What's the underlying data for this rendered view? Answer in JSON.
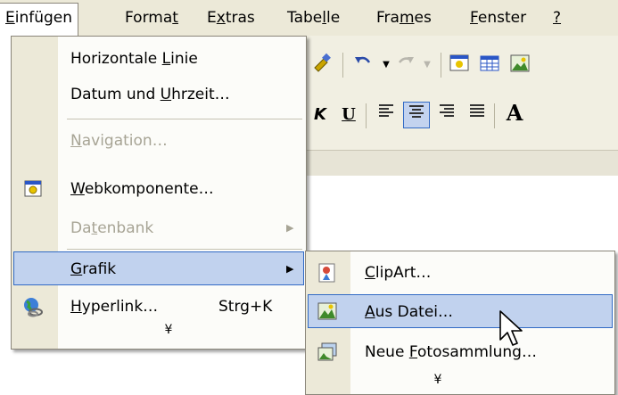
{
  "menubar": {
    "items": [
      {
        "label": "Einfügen",
        "mn": "E"
      },
      {
        "label": "Format",
        "mn": "t"
      },
      {
        "label": "Extras",
        "mn": "x"
      },
      {
        "label": "Tabelle",
        "mn": "l"
      },
      {
        "label": "Frames",
        "mn": "m"
      },
      {
        "label": "Fenster",
        "mn": "F"
      },
      {
        "label": "?",
        "mn": "?"
      }
    ]
  },
  "einfuegen_menu": {
    "items": [
      {
        "pre": "Horizontale ",
        "mn": "L",
        "post": "inie",
        "enabled": true
      },
      {
        "pre": "Datum und ",
        "mn": "U",
        "post": "hrzeit…",
        "enabled": true
      },
      {
        "pre": "",
        "mn": "N",
        "post": "avigation…",
        "enabled": false
      },
      {
        "pre": "",
        "mn": "W",
        "post": "ebkomponente…",
        "enabled": true,
        "icon": "web-component-icon"
      },
      {
        "pre": "Da",
        "mn": "t",
        "post": "enbank",
        "enabled": false,
        "submenu": true
      },
      {
        "pre": "",
        "mn": "G",
        "post": "rafik",
        "enabled": true,
        "submenu": true,
        "highlighted": true
      },
      {
        "pre": "",
        "mn": "H",
        "post": "yperlink…",
        "enabled": true,
        "shortcut": "Strg+K",
        "icon": "hyperlink-globe-icon"
      }
    ],
    "expand_glyph": "¥"
  },
  "grafik_submenu": {
    "items": [
      {
        "pre": "",
        "mn": "C",
        "post": "lipArt…",
        "icon": "clipart-icon"
      },
      {
        "pre": "",
        "mn": "A",
        "post": "us Datei…",
        "icon": "picture-from-file-icon",
        "highlighted": true
      },
      {
        "pre": "Neue ",
        "mn": "F",
        "post": "otosammlung…",
        "icon": "photo-gallery-icon"
      }
    ],
    "expand_glyph": "¥"
  },
  "toolbar": {
    "row1": [
      "format-painter-icon",
      "undo-icon",
      "redo-icon",
      "insert-component-icon",
      "insert-table-icon",
      "insert-picture-icon"
    ],
    "row2": {
      "italic": "K",
      "underline": "U",
      "grow_font": "A"
    }
  },
  "colors": {
    "menu_highlight": "#c1d2ee",
    "highlight_border": "#316ac5",
    "menubar_bg": "#ece9d8"
  }
}
